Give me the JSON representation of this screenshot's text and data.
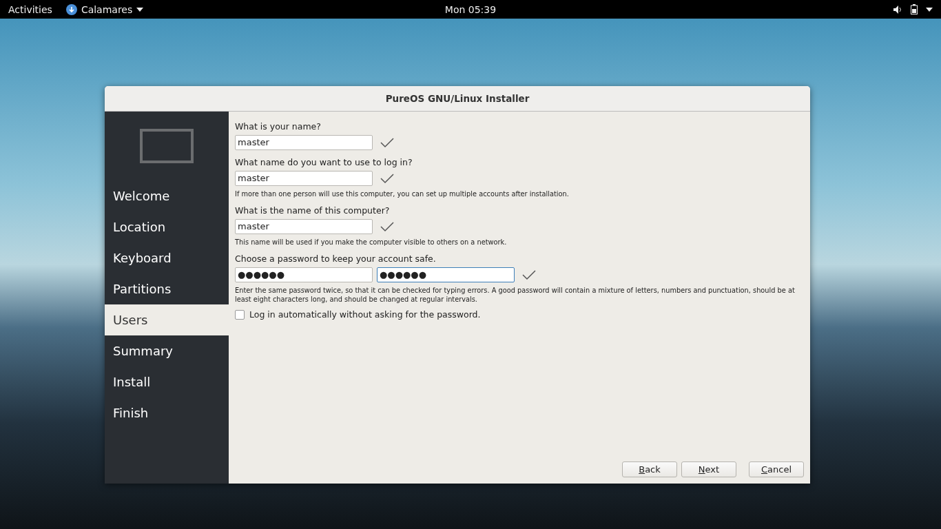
{
  "top_bar": {
    "activities": "Activities",
    "app_menu": "Calamares",
    "clock": "Mon 05:39"
  },
  "window": {
    "title": "PureOS GNU/Linux Installer"
  },
  "sidebar": {
    "items": [
      {
        "label": "Welcome",
        "selected": false
      },
      {
        "label": "Location",
        "selected": false
      },
      {
        "label": "Keyboard",
        "selected": false
      },
      {
        "label": "Partitions",
        "selected": false
      },
      {
        "label": "Users",
        "selected": true
      },
      {
        "label": "Summary",
        "selected": false
      },
      {
        "label": "Install",
        "selected": false
      },
      {
        "label": "Finish",
        "selected": false
      }
    ]
  },
  "form": {
    "sections": [
      {
        "question": "What is your name?",
        "fields": [
          {
            "value": "master",
            "focused": false
          }
        ],
        "valid": true
      },
      {
        "question": "What name do you want to use to log in?",
        "fields": [
          {
            "value": "master",
            "focused": false
          }
        ],
        "valid": true,
        "hint": "If more than one person will use this computer, you can set up multiple accounts after installation."
      },
      {
        "question": "What is the name of this computer?",
        "fields": [
          {
            "value": "master",
            "focused": false
          }
        ],
        "valid": true,
        "hint": "This name will be used if you make the computer visible to others on a network."
      },
      {
        "question": "Choose a password to keep your account safe.",
        "fields": [
          {
            "value": "●●●●●●",
            "focused": false
          },
          {
            "value": "●●●●●●",
            "focused": true
          }
        ],
        "valid": true,
        "hint": "Enter the same password twice, so that it can be checked for typing errors. A good password will contain a mixture of letters, numbers and punctuation, should be at least eight characters long, and should be changed at regular intervals."
      }
    ],
    "autologin": {
      "label": "Log in automatically without asking for the password.",
      "checked": false
    }
  },
  "buttons": [
    {
      "label": "Back"
    },
    {
      "label": "Next"
    },
    {
      "label": "Cancel"
    }
  ]
}
